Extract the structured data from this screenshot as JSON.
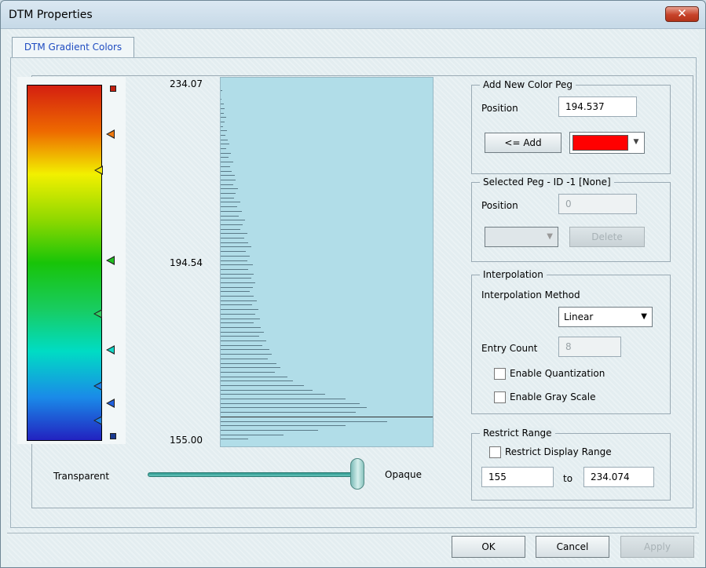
{
  "window": {
    "title": "DTM Properties",
    "close": "✕"
  },
  "tabs": [
    {
      "label": "DTM Gradient Colors",
      "active": true
    }
  ],
  "gradient": {
    "colors": [
      "#d41f10",
      "#ee6a00",
      "#f2f000",
      "#8ed800",
      "#18c408",
      "#18cc60",
      "#00dcc4",
      "#1a8ae8",
      "#2222c0"
    ],
    "pegs": [
      {
        "name": "peg-top-square",
        "color": "#c02010",
        "shape": "square"
      },
      {
        "name": "peg-orange",
        "color": "#f07a10",
        "shape": "arrow"
      },
      {
        "name": "peg-yellow",
        "color": "#f0e800",
        "shape": "arrow"
      },
      {
        "name": "peg-green",
        "color": "#20c020",
        "shape": "arrow"
      },
      {
        "name": "peg-lightgreen",
        "color": "#30d060",
        "shape": "arrow"
      },
      {
        "name": "peg-cyan",
        "color": "#10d8c8",
        "shape": "arrow"
      },
      {
        "name": "peg-blue-1",
        "color": "#1a80e8",
        "shape": "arrow"
      },
      {
        "name": "peg-blue-2",
        "color": "#2060e0",
        "shape": "arrow"
      },
      {
        "name": "peg-blue-3",
        "color": "#1a80e8",
        "shape": "arrow"
      },
      {
        "name": "peg-bottom-square",
        "color": "#1a3a90",
        "shape": "square"
      }
    ]
  },
  "histogram": {
    "max_label": "234.07",
    "mid_label": "194.54",
    "min_label": "155.00",
    "max_value": 234.07,
    "min_value": 155.0,
    "marker_value": 160.98,
    "bins": [
      2,
      0,
      1,
      4,
      6,
      5,
      8,
      6,
      3,
      9,
      7,
      10,
      12,
      8,
      15,
      11,
      18,
      14,
      16,
      20,
      22,
      18,
      25,
      21,
      19,
      28,
      24,
      30,
      26,
      35,
      32,
      28,
      38,
      34,
      40,
      44,
      36,
      42,
      38,
      46,
      40,
      48,
      44,
      50,
      46,
      42,
      48,
      52,
      45,
      54,
      50,
      56,
      48,
      58,
      62,
      55,
      66,
      60,
      70,
      74,
      68,
      80,
      86,
      78,
      96,
      104,
      120,
      132,
      150,
      180,
      200,
      210,
      195,
      220,
      240,
      180,
      140,
      90,
      40
    ]
  },
  "opacity": {
    "left_label": "Transparent",
    "right_label": "Opaque",
    "value": 1.0
  },
  "add_peg": {
    "title": "Add New Color Peg",
    "position_label": "Position",
    "position_value": "194.537",
    "add_label": "<= Add",
    "color": "#ff0000"
  },
  "selected_peg": {
    "title": "Selected Peg - ID -1 [None]",
    "position_label": "Position",
    "position_value": "0",
    "delete_label": "Delete"
  },
  "interpolation": {
    "title": "Interpolation",
    "method_label": "Interpolation Method",
    "method_value": "Linear",
    "entry_count_label": "Entry Count",
    "entry_count_value": "8",
    "quantization_label": "Enable Quantization",
    "grayscale_label": "Enable Gray Scale"
  },
  "restrict": {
    "title": "Restrict Range",
    "checkbox_label": "Restrict Display Range",
    "from_value": "155",
    "to_label": "to",
    "to_value": "234.074"
  },
  "footer": {
    "ok": "OK",
    "cancel": "Cancel",
    "apply": "Apply"
  },
  "icons": {
    "dropdown": "▼"
  }
}
